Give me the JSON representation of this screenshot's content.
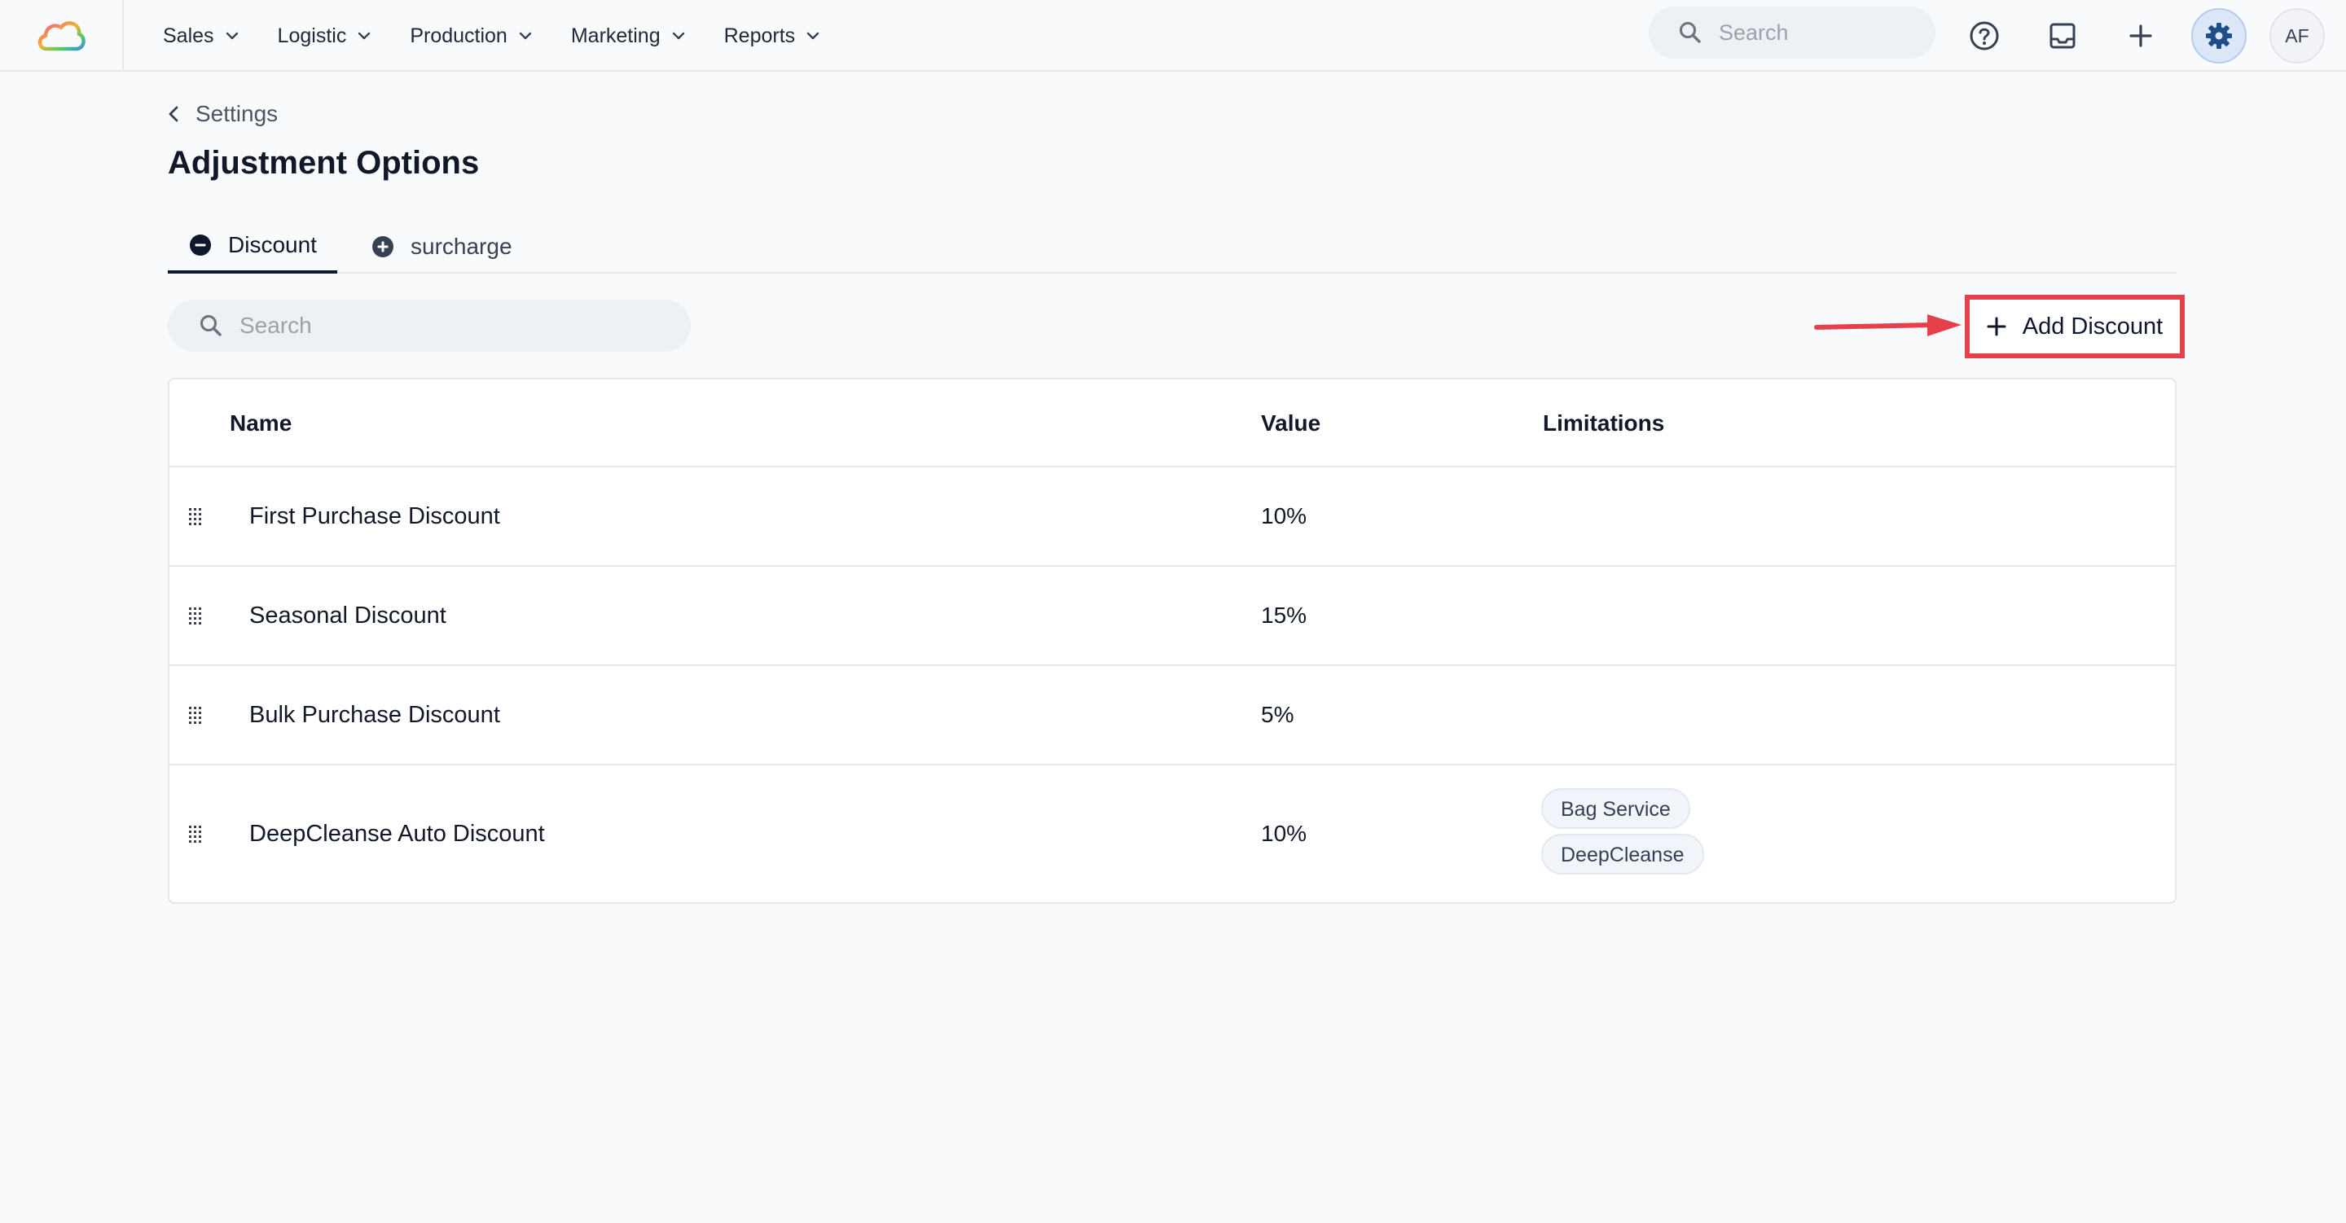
{
  "topbar": {
    "nav": [
      {
        "label": "Sales"
      },
      {
        "label": "Logistic"
      },
      {
        "label": "Production"
      },
      {
        "label": "Marketing"
      },
      {
        "label": "Reports"
      }
    ],
    "search_placeholder": "Search",
    "icons": [
      "app-logo",
      "help-icon",
      "inbox-icon",
      "plus-icon",
      "gear-icon"
    ],
    "avatar_initials": "AF",
    "accent_color": "#1e4e8c"
  },
  "breadcrumb": {
    "back_label": "Settings"
  },
  "page_title": "Adjustment Options",
  "tabs": [
    {
      "label": "Discount",
      "icon": "minus-circle-icon",
      "active": true
    },
    {
      "label": "surcharge",
      "icon": "plus-circle-icon",
      "active": false
    }
  ],
  "list_search_placeholder": "Search",
  "add_button_label": "Add Discount",
  "highlight_color": "#e5414d",
  "table": {
    "columns": [
      "Name",
      "Value",
      "Limitations"
    ],
    "rows": [
      {
        "name": "First Purchase Discount",
        "value": "10%",
        "limitations": []
      },
      {
        "name": "Seasonal Discount",
        "value": "15%",
        "limitations": []
      },
      {
        "name": "Bulk Purchase Discount",
        "value": "5%",
        "limitations": []
      },
      {
        "name": "DeepCleanse Auto Discount",
        "value": "10%",
        "limitations": [
          "Bag Service",
          "DeepCleanse"
        ]
      }
    ]
  }
}
